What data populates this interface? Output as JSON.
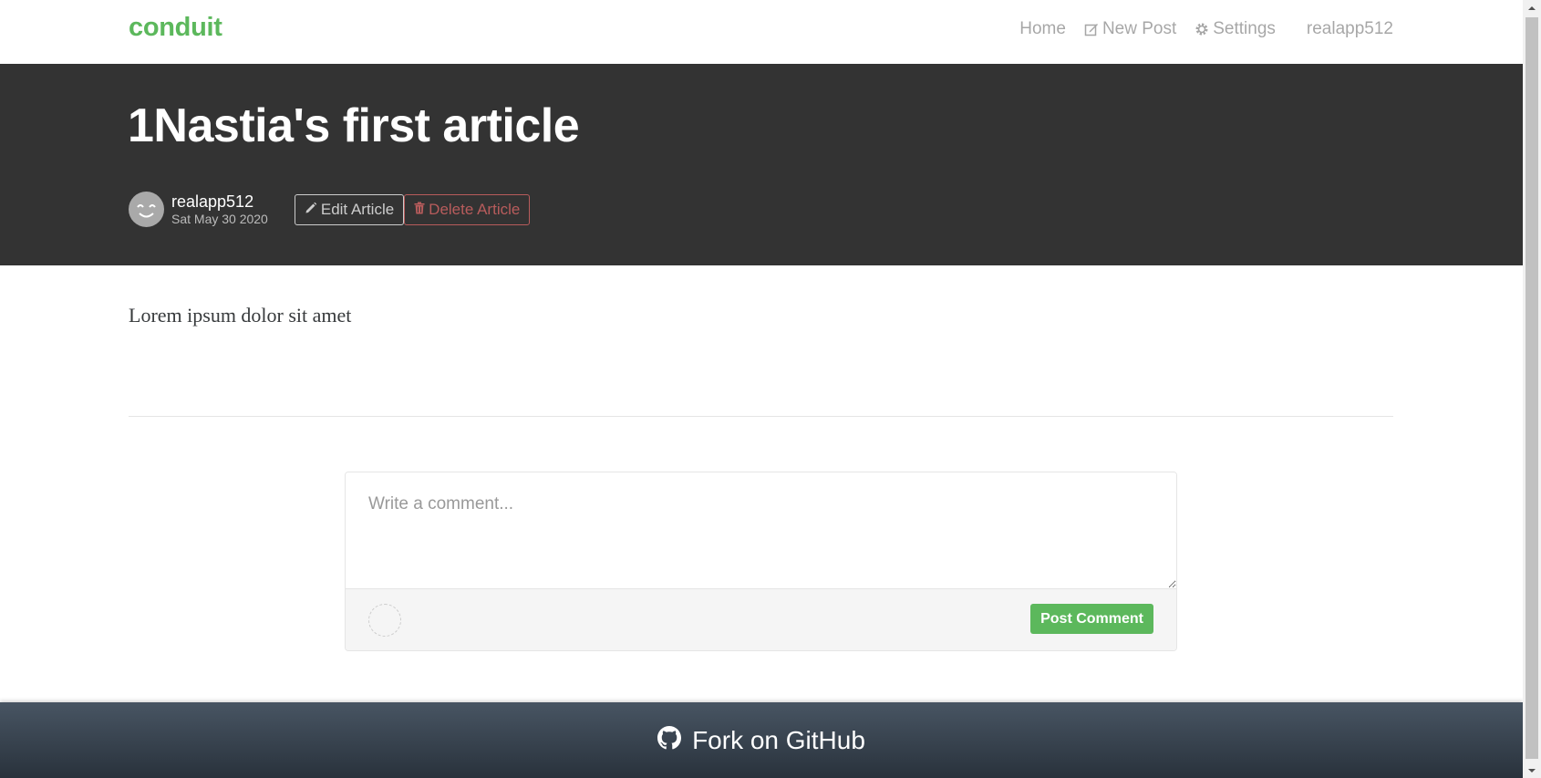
{
  "brand": "conduit",
  "nav": {
    "home": "Home",
    "new_post": "New Post",
    "settings": "Settings",
    "user": "realapp512"
  },
  "article": {
    "title": "1Nastia's first article",
    "author": "realapp512",
    "date": "Sat May 30 2020",
    "edit_label": "Edit Article",
    "delete_label": "Delete Article",
    "body": "Lorem ipsum dolor sit amet"
  },
  "comment": {
    "placeholder": "Write a comment...",
    "value": "",
    "post_label": "Post Comment"
  },
  "footer": {
    "link_text": "Fork on GitHub"
  },
  "colors": {
    "brand": "#5cb85c",
    "banner": "#333333",
    "danger": "#b85c5c"
  }
}
